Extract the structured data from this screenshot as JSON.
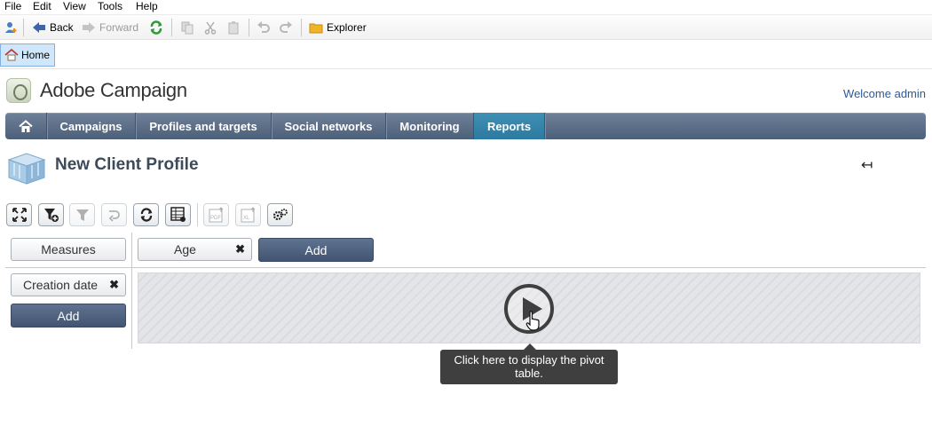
{
  "menubar": {
    "items": [
      "File",
      "Edit",
      "View",
      "Tools",
      "Help"
    ]
  },
  "toolbar": {
    "back_label": "Back",
    "forward_label": "Forward",
    "explorer_label": "Explorer"
  },
  "tabs": {
    "home_label": "Home"
  },
  "header": {
    "app_title": "Adobe Campaign",
    "welcome": "Welcome admin"
  },
  "nav": {
    "items": [
      "Campaigns",
      "Profiles and targets",
      "Social networks",
      "Monitoring",
      "Reports"
    ],
    "active": "Reports"
  },
  "page": {
    "title": "New Client Profile",
    "back_glyph": "↤"
  },
  "pivot": {
    "measures_label": "Measures",
    "column_dimension": "Age",
    "row_dimension": "Creation date",
    "add_column_label": "Add",
    "add_row_label": "Add",
    "remove_glyph": "✖",
    "tooltip": "Click here to display the pivot table."
  },
  "colors": {
    "nav_bg": "#5a6c85",
    "nav_active": "#3385ad",
    "add_button": "#4d6080",
    "title_text": "#3d4a5a",
    "welcome_text": "#2a5a9c"
  }
}
